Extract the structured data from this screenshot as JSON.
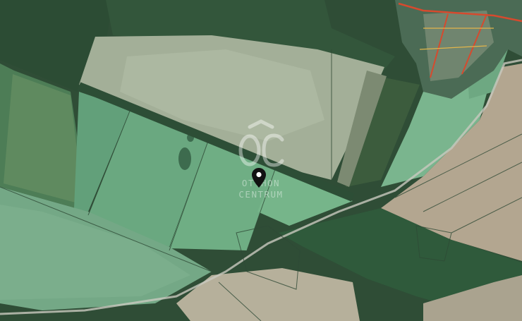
{
  "map": {
    "type": "satellite",
    "watermark": {
      "logo_letters": "OC",
      "line1": "OTTHON",
      "line2": "CENTRUM"
    },
    "marker_icon": "location-pin-icon",
    "colors": {
      "forest": "#2f5a3a",
      "pale_field": "#a9b79f",
      "green_field": "#5f9a72",
      "bright_field": "#6aa880",
      "ploughed": "#b1a48e",
      "road": "#c9c9bf",
      "village_road": "#d64a2e"
    }
  }
}
